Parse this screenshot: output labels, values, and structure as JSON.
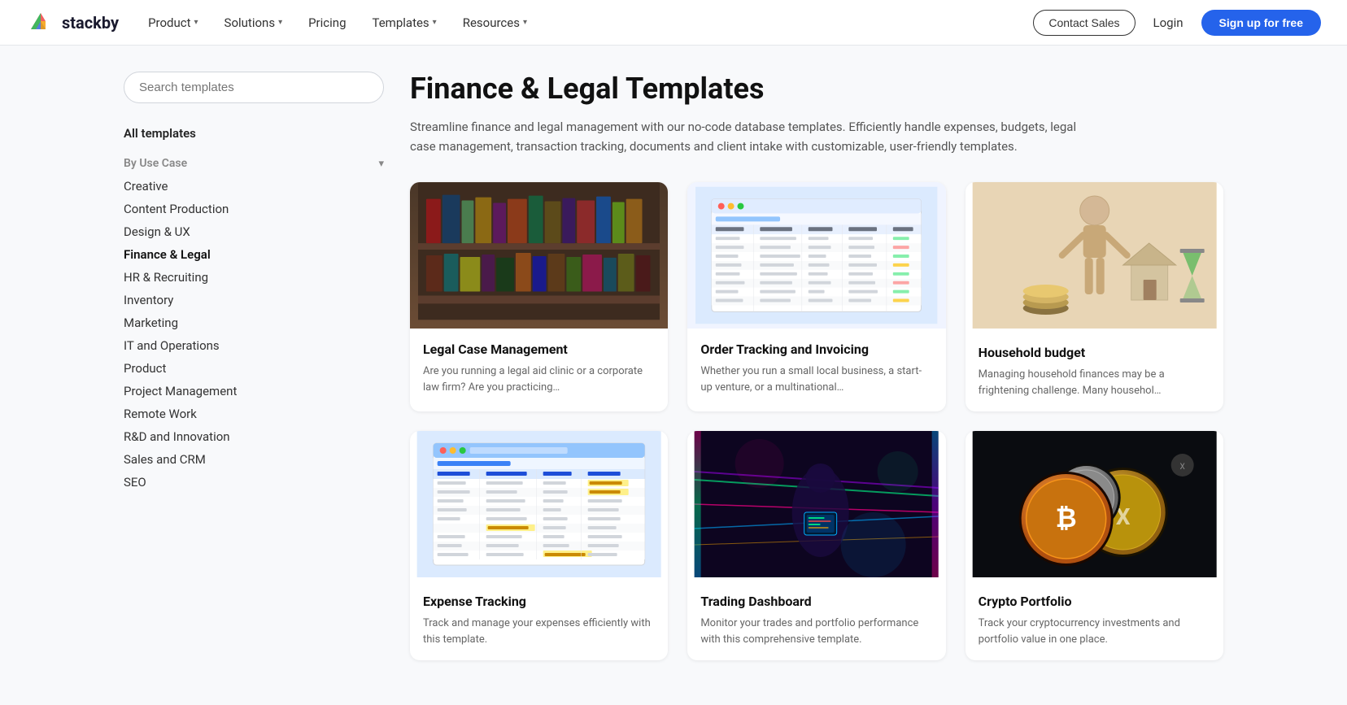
{
  "nav": {
    "logo_text": "stackby",
    "items": [
      {
        "label": "Product",
        "has_dropdown": true
      },
      {
        "label": "Solutions",
        "has_dropdown": true
      },
      {
        "label": "Pricing",
        "has_dropdown": false
      },
      {
        "label": "Templates",
        "has_dropdown": true
      },
      {
        "label": "Resources",
        "has_dropdown": true
      }
    ],
    "contact_sales": "Contact Sales",
    "login": "Login",
    "signup": "Sign up for free"
  },
  "sidebar": {
    "search_placeholder": "Search templates",
    "all_templates": "All templates",
    "by_use_case": {
      "label": "By Use Case",
      "items": [
        {
          "label": "Creative",
          "active": false
        },
        {
          "label": "Content Production",
          "active": false
        },
        {
          "label": "Design & UX",
          "active": false
        },
        {
          "label": "Finance & Legal",
          "active": true
        },
        {
          "label": "HR & Recruiting",
          "active": false
        },
        {
          "label": "Inventory",
          "active": false
        },
        {
          "label": "Marketing",
          "active": false
        },
        {
          "label": "IT and Operations",
          "active": false
        },
        {
          "label": "Product",
          "active": false
        },
        {
          "label": "Project Management",
          "active": false
        },
        {
          "label": "Remote Work",
          "active": false
        },
        {
          "label": "R&D and Innovation",
          "active": false
        },
        {
          "label": "Sales and CRM",
          "active": false
        },
        {
          "label": "SEO",
          "active": false
        }
      ]
    }
  },
  "content": {
    "title": "Finance & Legal Templates",
    "description": "Streamline finance and legal management with our no-code database templates. Efficiently handle expenses, budgets, legal case management, transaction tracking, documents and client intake with customizable, user-friendly templates.",
    "templates": [
      {
        "id": "legal-case-management",
        "title": "Legal Case Management",
        "description": "Are you running a legal aid clinic or a corporate law firm? Are you practicing…",
        "image_type": "books"
      },
      {
        "id": "order-tracking-invoicing",
        "title": "Order Tracking and Invoicing",
        "description": "Whether you run a small local business, a start-up venture, or a multinational…",
        "image_type": "spreadsheet"
      },
      {
        "id": "household-budget",
        "title": "Household budget",
        "description": "Managing household finances may be a frightening challenge. Many househol…",
        "image_type": "figurine"
      },
      {
        "id": "expense-tracking",
        "title": "Expense Tracking",
        "description": "Track and manage your expenses efficiently with this template.",
        "image_type": "expense"
      },
      {
        "id": "trading-dashboard",
        "title": "Trading Dashboard",
        "description": "Monitor your trades and portfolio performance with this comprehensive template.",
        "image_type": "neon"
      },
      {
        "id": "crypto-portfolio",
        "title": "Crypto Portfolio",
        "description": "Track your cryptocurrency investments and portfolio value in one place.",
        "image_type": "crypto"
      }
    ]
  }
}
